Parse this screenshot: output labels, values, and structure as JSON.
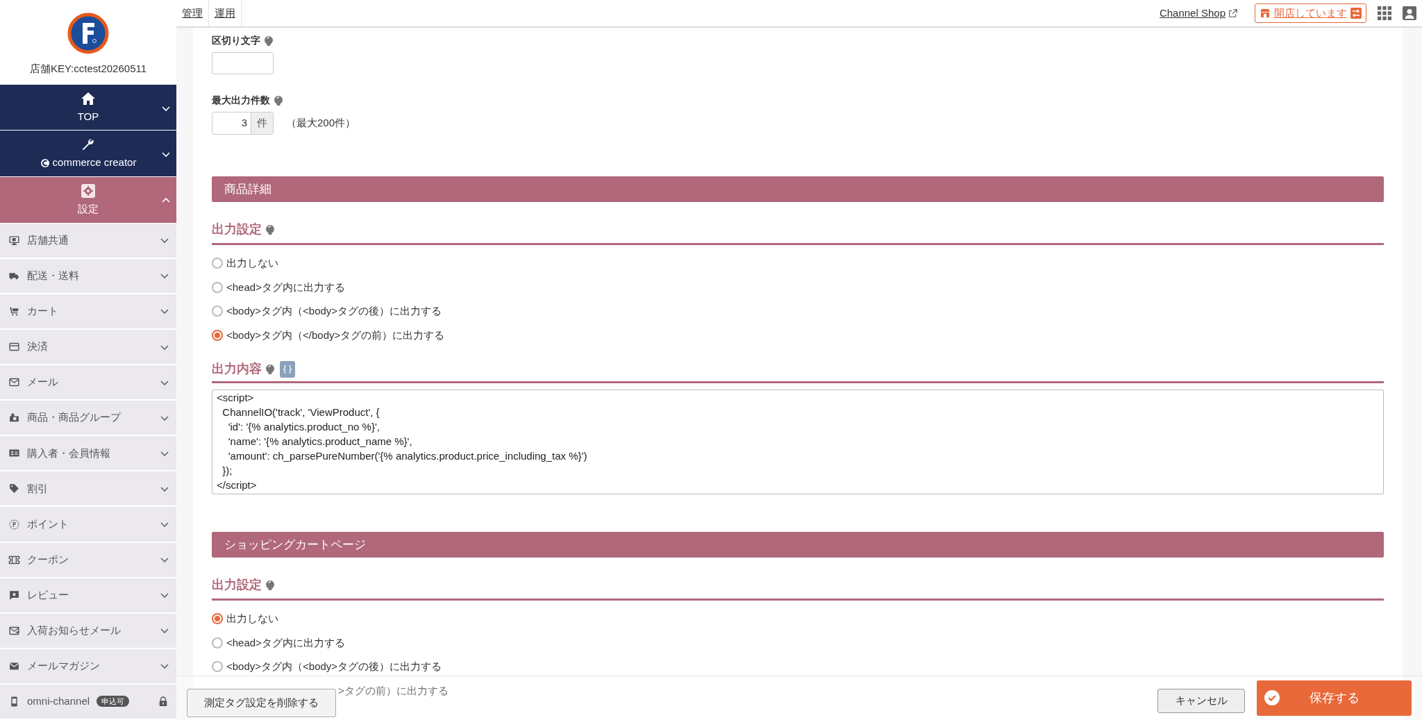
{
  "sidebar": {
    "shop_key": "店舗KEY:cctest20260511",
    "main_items": [
      {
        "label": "TOP",
        "expanded": false
      },
      {
        "label": "commerce creator",
        "expanded": false
      },
      {
        "label": "設定",
        "expanded": true
      }
    ],
    "items": [
      {
        "label": "店舗共通"
      },
      {
        "label": "配送・送料"
      },
      {
        "label": "カート"
      },
      {
        "label": "決済"
      },
      {
        "label": "メール"
      },
      {
        "label": "商品・商品グループ"
      },
      {
        "label": "購入者・会員情報"
      },
      {
        "label": "割引"
      },
      {
        "label": "ポイント"
      },
      {
        "label": "クーポン"
      },
      {
        "label": "レビュー"
      },
      {
        "label": "入荷お知らせメール"
      },
      {
        "label": "メールマガジン"
      },
      {
        "label": "omni-channel",
        "badge": "申込可",
        "locked": true
      }
    ]
  },
  "top_bar": {
    "tabs": [
      {
        "label": "管理"
      },
      {
        "label": "運用"
      }
    ],
    "shop_link": "Channel Shop",
    "store_status": "開店しています"
  },
  "fields": [
    {
      "label": "区切り文字"
    },
    {
      "label": "最大出力件数",
      "value": "3",
      "unit": "件",
      "note": "（最大200件）"
    }
  ],
  "sections": [
    {
      "title": "商品詳細",
      "output_setting_label": "出力設定",
      "options": [
        {
          "kind": "full",
          "label": "出力しない",
          "selected": false
        },
        {
          "kind": "full",
          "label": "<head>タグ内に出力する",
          "selected": false
        },
        {
          "kind": "full",
          "label": "<body>タグ内（<body>タグの後）に出力する",
          "selected": false
        },
        {
          "kind": "full",
          "label": "<body>タグ内（</body>タグの前）に出力する",
          "selected": true
        }
      ],
      "content_label": "出力内容",
      "code_lines": [
        "<script>",
        "  ChannelIO('track', 'ViewProduct', {",
        "    'id': '{% analytics.product_no %}',",
        "    'name': '{% analytics.product_name %}',",
        "    'amount': ch_parsePureNumber('{% analytics.product.price_including_tax %}')",
        "  });",
        "</script>"
      ]
    },
    {
      "title": "ショッピングカートページ",
      "output_setting_label": "出力設定",
      "options": [
        {
          "kind": "full",
          "label": "出力しない",
          "selected": true
        },
        {
          "kind": "full",
          "label": "<head>タグ内に出力する",
          "selected": false
        },
        {
          "kind": "full",
          "label": "<body>タグ内（<body>タグの後）に出力する",
          "selected": false
        },
        {
          "kind": "clipped",
          "label": ">タグの前）に出力する"
        }
      ]
    }
  ],
  "footer": {
    "delete_button": "測定タグ設定を削除する",
    "cancel_button": "キャンセル",
    "save_button": "保存する"
  }
}
